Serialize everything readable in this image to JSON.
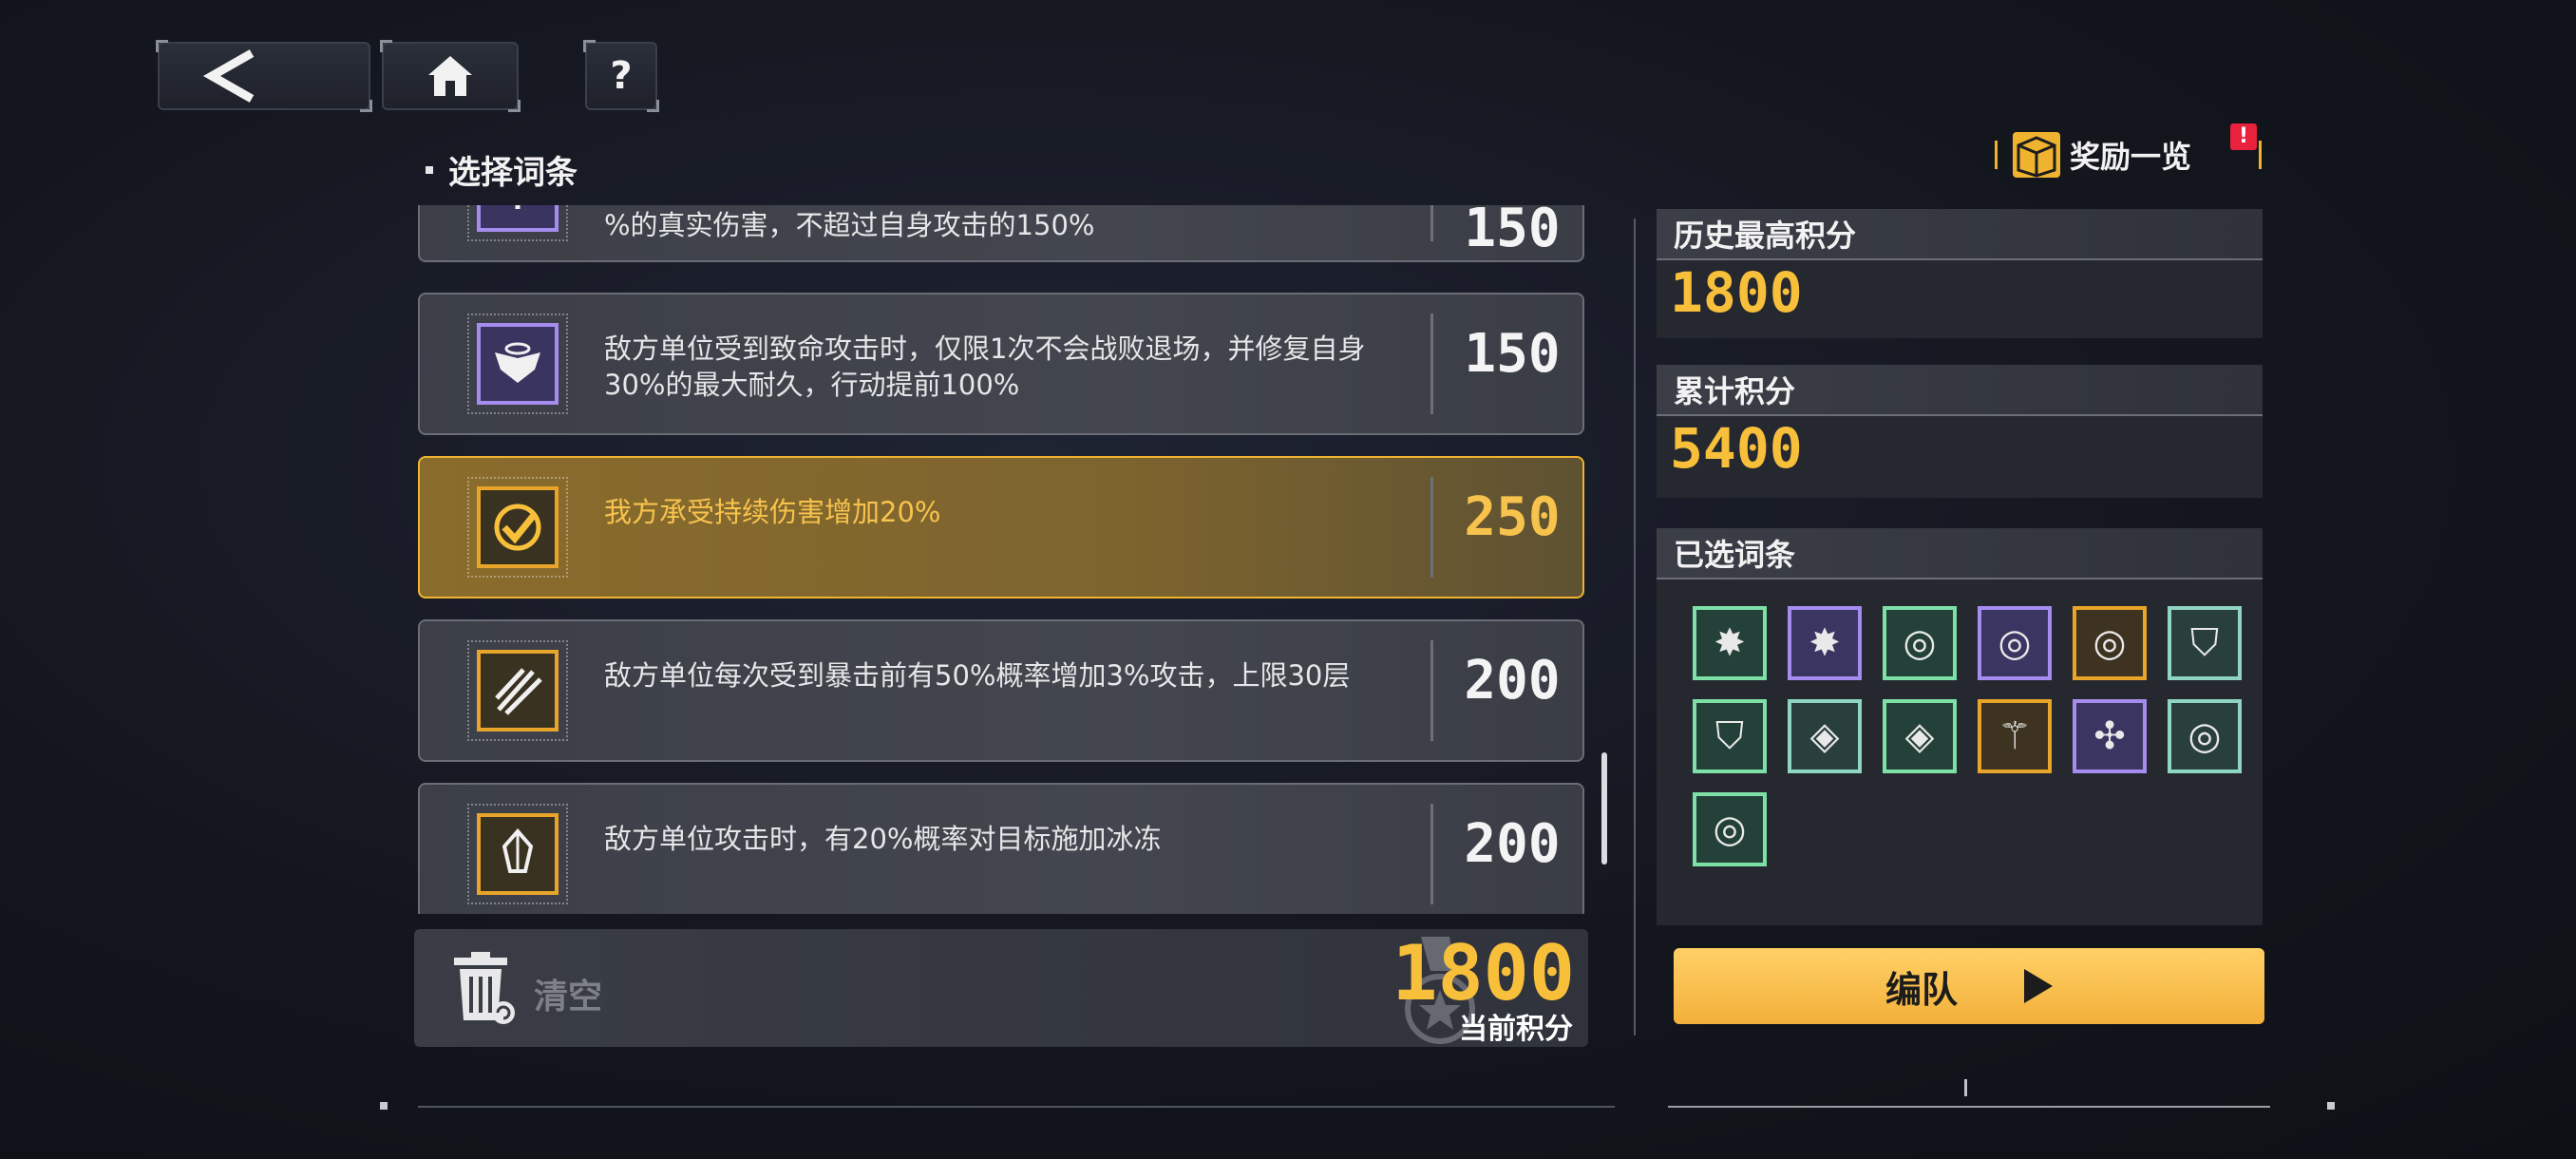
{
  "nav": {
    "back_icon": "<",
    "home_icon": "home-icon",
    "help_icon": "?"
  },
  "section_title": "选择词条",
  "entries": [
    {
      "desc": "%的真实伤害，不超过自身攻击的150%",
      "score": "150",
      "icon": "trident-icon",
      "color": "purple"
    },
    {
      "desc": "敌方单位受到致命攻击时，仅限1次不会战败退场，并修复自身30%的最大耐久，行动提前100%",
      "score": "150",
      "icon": "winged-halo-icon",
      "color": "purple"
    },
    {
      "desc": "我方承受持续伤害增加20%",
      "score": "250",
      "icon": "check-target-icon",
      "color": "gold",
      "selected": true
    },
    {
      "desc": "敌方单位每次受到暴击前有50%概率增加3%攻击，上限30层",
      "score": "200",
      "icon": "claw-icon",
      "color": "gold"
    },
    {
      "desc": "敌方单位攻击时，有20%概率对目标施加冰冻",
      "score": "200",
      "icon": "ice-crystal-icon",
      "color": "gold"
    }
  ],
  "bottom": {
    "clear_label": "清空",
    "current_score": "1800",
    "current_score_label": "当前积分"
  },
  "reward": {
    "label": "奖励一览",
    "alert": "!"
  },
  "history_high": {
    "label": "历史最高积分",
    "value": "1800"
  },
  "cumulative": {
    "label": "累计积分",
    "value": "5400"
  },
  "selected_tags": {
    "label": "已选词条",
    "tags": [
      {
        "color": "green",
        "glyph": "✸"
      },
      {
        "color": "purple",
        "glyph": "✸"
      },
      {
        "color": "green",
        "glyph": "◎"
      },
      {
        "color": "purple",
        "glyph": "◎"
      },
      {
        "color": "gold",
        "glyph": "◎"
      },
      {
        "color": "teal",
        "glyph": "⛉"
      },
      {
        "color": "green",
        "glyph": "⛉"
      },
      {
        "color": "teal",
        "glyph": "◈"
      },
      {
        "color": "green",
        "glyph": "◈"
      },
      {
        "color": "gold",
        "glyph": "⚚"
      },
      {
        "color": "purple",
        "glyph": "✣"
      },
      {
        "color": "teal",
        "glyph": "◎"
      },
      {
        "color": "green",
        "glyph": "◎"
      }
    ]
  },
  "deploy_label": "编队",
  "colors": {
    "accent": "#f8c03a",
    "selected_border": "#f0b330"
  }
}
